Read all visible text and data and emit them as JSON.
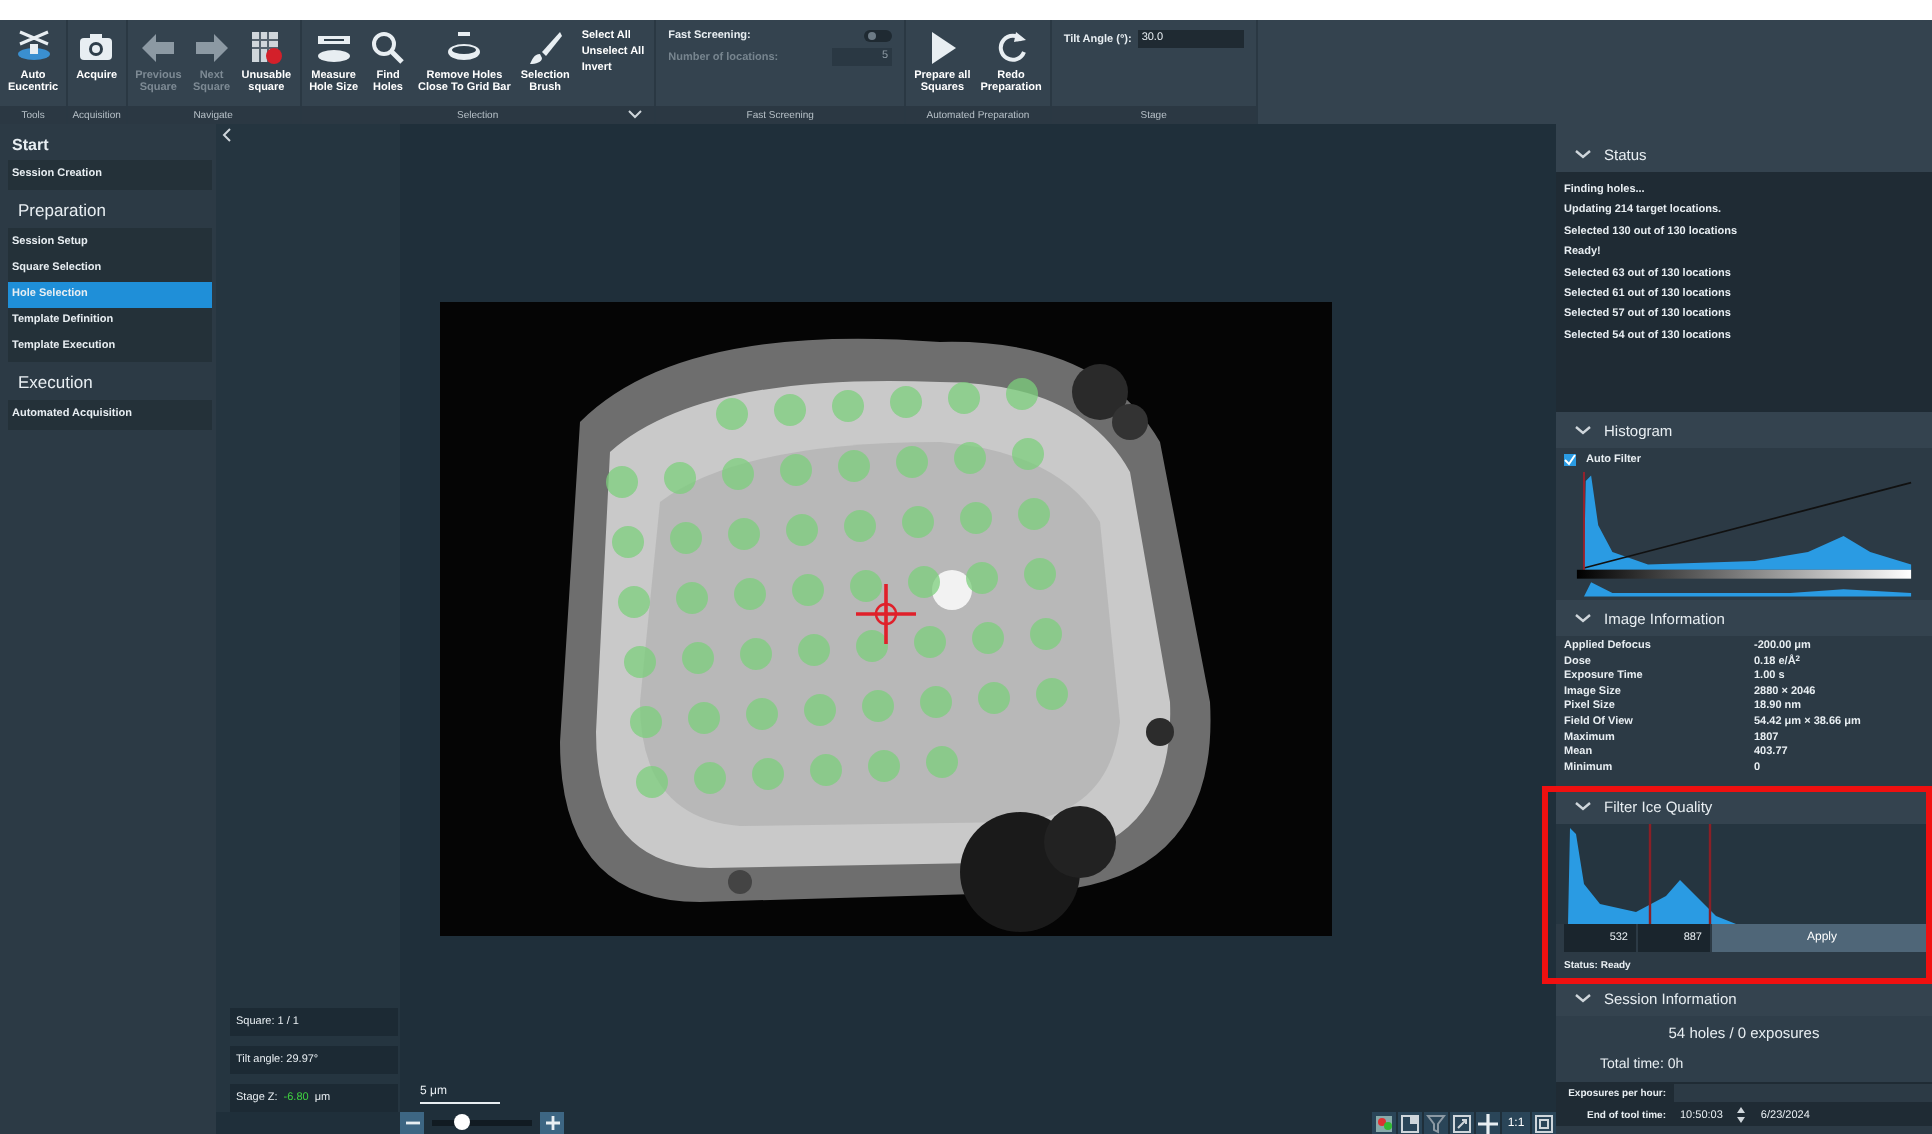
{
  "toolbar": {
    "groups": [
      {
        "label": "Tools",
        "items": [
          {
            "kind": "button",
            "label": "Auto\nEucentric",
            "disabled": false
          }
        ]
      },
      {
        "label": "Acquisition",
        "items": [
          {
            "kind": "button",
            "label": "Acquire",
            "disabled": false
          }
        ]
      },
      {
        "label": "Navigate",
        "items": [
          {
            "kind": "button",
            "label": "Previous\nSquare",
            "disabled": true
          },
          {
            "kind": "button",
            "label": "Next\nSquare",
            "disabled": true
          },
          {
            "kind": "button",
            "label": "Unusable\nsquare",
            "disabled": false
          }
        ]
      },
      {
        "label": "Selection",
        "menu": true,
        "items": [
          {
            "kind": "button",
            "label": "Measure\nHole Size",
            "disabled": false
          },
          {
            "kind": "button",
            "label": "Find\nHoles",
            "disabled": false
          },
          {
            "kind": "button",
            "label": "Remove Holes\nClose To Grid Bar",
            "disabled": false
          },
          {
            "kind": "button",
            "label": "Selection\nBrush",
            "disabled": false
          },
          {
            "kind": "links",
            "labels": [
              "Select All",
              "Unselect All",
              "Invert"
            ]
          }
        ]
      },
      {
        "label": "Fast Screening",
        "items": [
          {
            "kind": "fast-screening",
            "toggle_label": "Fast Screening:",
            "on": false,
            "count_label": "Number of locations:",
            "count": "5",
            "disabled": true
          }
        ]
      },
      {
        "label": "Automated Preparation",
        "items": [
          {
            "kind": "button",
            "label": "Prepare all\nSquares",
            "disabled": false
          },
          {
            "kind": "button",
            "label": "Redo\nPreparation",
            "disabled": false
          }
        ]
      },
      {
        "label": "Stage",
        "items": [
          {
            "kind": "field",
            "label": "Tilt Angle (°):",
            "value": "30.0"
          }
        ]
      }
    ]
  },
  "sidebar": {
    "sections": [
      {
        "title": "Start",
        "items": [
          {
            "label": "Session Creation",
            "selected": false
          }
        ]
      },
      {
        "title": "Preparation",
        "items": [
          {
            "label": "Session Setup",
            "selected": false
          },
          {
            "label": "Square Selection",
            "selected": false
          },
          {
            "label": "Hole Selection",
            "selected": true
          },
          {
            "label": "Template Definition",
            "selected": false
          },
          {
            "label": "Template Execution",
            "selected": false
          }
        ]
      },
      {
        "title": "Execution",
        "items": [
          {
            "label": "Automated Acquisition",
            "selected": false
          }
        ]
      }
    ]
  },
  "viewer": {
    "info": [
      {
        "label": "Square: 1 / 1"
      },
      {
        "label": "Tilt angle: 29.97°"
      },
      {
        "label": "Stage Z:",
        "value": "-6.80",
        "unit": "μm"
      }
    ],
    "scale_bar": "5 μm",
    "zoom": {
      "level": 0.3
    },
    "actual_size": "1:1"
  },
  "panel": {
    "status": {
      "title": "Status",
      "expanded": true,
      "lines": [
        "Finding holes...",
        "Updating 214 target locations.",
        "Selected 130 out of 130 locations",
        "Ready!",
        "Selected 63 out of 130 locations",
        "Selected 61 out of 130 locations",
        "Selected 57 out of 130 locations",
        "Selected 54 out of 130 locations"
      ]
    },
    "histogram": {
      "title": "Histogram",
      "expanded": true,
      "auto_filter": {
        "label": "Auto Filter",
        "checked": true
      }
    },
    "image_information": {
      "title": "Image Information",
      "expanded": true,
      "rows": [
        {
          "label": "Applied Defocus",
          "value": "-200.00 μm"
        },
        {
          "label": "Dose",
          "value": "0.18 e/Å$^{2}$"
        },
        {
          "label": "Exposure Time",
          "value": "1.00 s"
        },
        {
          "label": "Image Size",
          "value": "2880 × 2046"
        },
        {
          "label": "Pixel Size",
          "value": "18.90 nm"
        },
        {
          "label": "Field Of View",
          "value": "54.42 μm × 38.66 μm"
        },
        {
          "label": "Maximum",
          "value": "1807"
        },
        {
          "label": "Mean",
          "value": "403.77"
        },
        {
          "label": "Minimum",
          "value": "0"
        }
      ]
    },
    "filter_ice_quality": {
      "title": "Filter Ice Quality",
      "expanded": true,
      "highlighted": true,
      "low": "532",
      "high": "887",
      "apply": "Apply",
      "status": "Status: Ready"
    },
    "session_information": {
      "title": "Session Information",
      "expanded": true,
      "summary": "54 holes / 0 exposures",
      "total_time": "Total time: 0h",
      "exposures_per_hour": {
        "label": "Exposures per hour:"
      },
      "end_of_tool_time": {
        "label": "End of tool time:",
        "time": "10:50:03",
        "date": "6/23/2024"
      }
    }
  }
}
